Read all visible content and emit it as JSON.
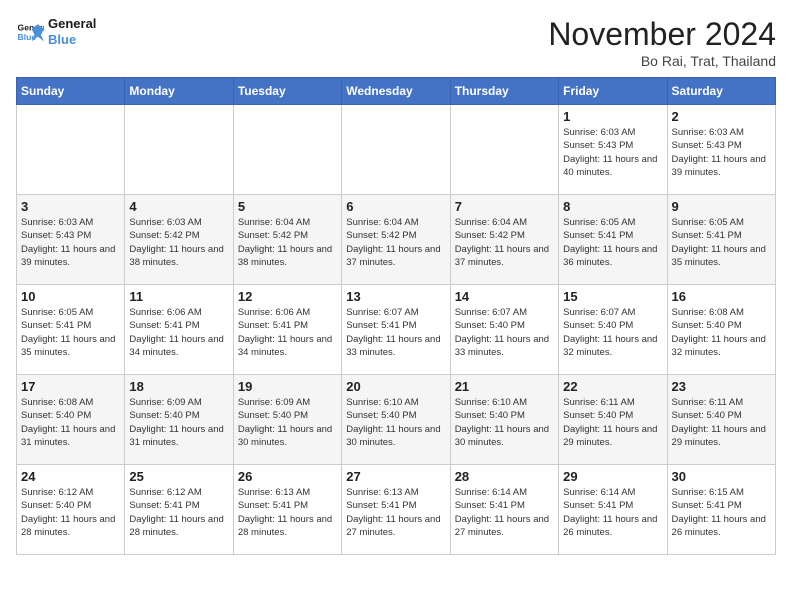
{
  "logo": {
    "text_general": "General",
    "text_blue": "Blue"
  },
  "title": "November 2024",
  "location": "Bo Rai, Trat, Thailand",
  "days_of_week": [
    "Sunday",
    "Monday",
    "Tuesday",
    "Wednesday",
    "Thursday",
    "Friday",
    "Saturday"
  ],
  "weeks": [
    [
      {
        "day": "",
        "info": ""
      },
      {
        "day": "",
        "info": ""
      },
      {
        "day": "",
        "info": ""
      },
      {
        "day": "",
        "info": ""
      },
      {
        "day": "",
        "info": ""
      },
      {
        "day": "1",
        "info": "Sunrise: 6:03 AM\nSunset: 5:43 PM\nDaylight: 11 hours and 40 minutes."
      },
      {
        "day": "2",
        "info": "Sunrise: 6:03 AM\nSunset: 5:43 PM\nDaylight: 11 hours and 39 minutes."
      }
    ],
    [
      {
        "day": "3",
        "info": "Sunrise: 6:03 AM\nSunset: 5:43 PM\nDaylight: 11 hours and 39 minutes."
      },
      {
        "day": "4",
        "info": "Sunrise: 6:03 AM\nSunset: 5:42 PM\nDaylight: 11 hours and 38 minutes."
      },
      {
        "day": "5",
        "info": "Sunrise: 6:04 AM\nSunset: 5:42 PM\nDaylight: 11 hours and 38 minutes."
      },
      {
        "day": "6",
        "info": "Sunrise: 6:04 AM\nSunset: 5:42 PM\nDaylight: 11 hours and 37 minutes."
      },
      {
        "day": "7",
        "info": "Sunrise: 6:04 AM\nSunset: 5:42 PM\nDaylight: 11 hours and 37 minutes."
      },
      {
        "day": "8",
        "info": "Sunrise: 6:05 AM\nSunset: 5:41 PM\nDaylight: 11 hours and 36 minutes."
      },
      {
        "day": "9",
        "info": "Sunrise: 6:05 AM\nSunset: 5:41 PM\nDaylight: 11 hours and 35 minutes."
      }
    ],
    [
      {
        "day": "10",
        "info": "Sunrise: 6:05 AM\nSunset: 5:41 PM\nDaylight: 11 hours and 35 minutes."
      },
      {
        "day": "11",
        "info": "Sunrise: 6:06 AM\nSunset: 5:41 PM\nDaylight: 11 hours and 34 minutes."
      },
      {
        "day": "12",
        "info": "Sunrise: 6:06 AM\nSunset: 5:41 PM\nDaylight: 11 hours and 34 minutes."
      },
      {
        "day": "13",
        "info": "Sunrise: 6:07 AM\nSunset: 5:41 PM\nDaylight: 11 hours and 33 minutes."
      },
      {
        "day": "14",
        "info": "Sunrise: 6:07 AM\nSunset: 5:40 PM\nDaylight: 11 hours and 33 minutes."
      },
      {
        "day": "15",
        "info": "Sunrise: 6:07 AM\nSunset: 5:40 PM\nDaylight: 11 hours and 32 minutes."
      },
      {
        "day": "16",
        "info": "Sunrise: 6:08 AM\nSunset: 5:40 PM\nDaylight: 11 hours and 32 minutes."
      }
    ],
    [
      {
        "day": "17",
        "info": "Sunrise: 6:08 AM\nSunset: 5:40 PM\nDaylight: 11 hours and 31 minutes."
      },
      {
        "day": "18",
        "info": "Sunrise: 6:09 AM\nSunset: 5:40 PM\nDaylight: 11 hours and 31 minutes."
      },
      {
        "day": "19",
        "info": "Sunrise: 6:09 AM\nSunset: 5:40 PM\nDaylight: 11 hours and 30 minutes."
      },
      {
        "day": "20",
        "info": "Sunrise: 6:10 AM\nSunset: 5:40 PM\nDaylight: 11 hours and 30 minutes."
      },
      {
        "day": "21",
        "info": "Sunrise: 6:10 AM\nSunset: 5:40 PM\nDaylight: 11 hours and 30 minutes."
      },
      {
        "day": "22",
        "info": "Sunrise: 6:11 AM\nSunset: 5:40 PM\nDaylight: 11 hours and 29 minutes."
      },
      {
        "day": "23",
        "info": "Sunrise: 6:11 AM\nSunset: 5:40 PM\nDaylight: 11 hours and 29 minutes."
      }
    ],
    [
      {
        "day": "24",
        "info": "Sunrise: 6:12 AM\nSunset: 5:40 PM\nDaylight: 11 hours and 28 minutes."
      },
      {
        "day": "25",
        "info": "Sunrise: 6:12 AM\nSunset: 5:41 PM\nDaylight: 11 hours and 28 minutes."
      },
      {
        "day": "26",
        "info": "Sunrise: 6:13 AM\nSunset: 5:41 PM\nDaylight: 11 hours and 28 minutes."
      },
      {
        "day": "27",
        "info": "Sunrise: 6:13 AM\nSunset: 5:41 PM\nDaylight: 11 hours and 27 minutes."
      },
      {
        "day": "28",
        "info": "Sunrise: 6:14 AM\nSunset: 5:41 PM\nDaylight: 11 hours and 27 minutes."
      },
      {
        "day": "29",
        "info": "Sunrise: 6:14 AM\nSunset: 5:41 PM\nDaylight: 11 hours and 26 minutes."
      },
      {
        "day": "30",
        "info": "Sunrise: 6:15 AM\nSunset: 5:41 PM\nDaylight: 11 hours and 26 minutes."
      }
    ]
  ]
}
